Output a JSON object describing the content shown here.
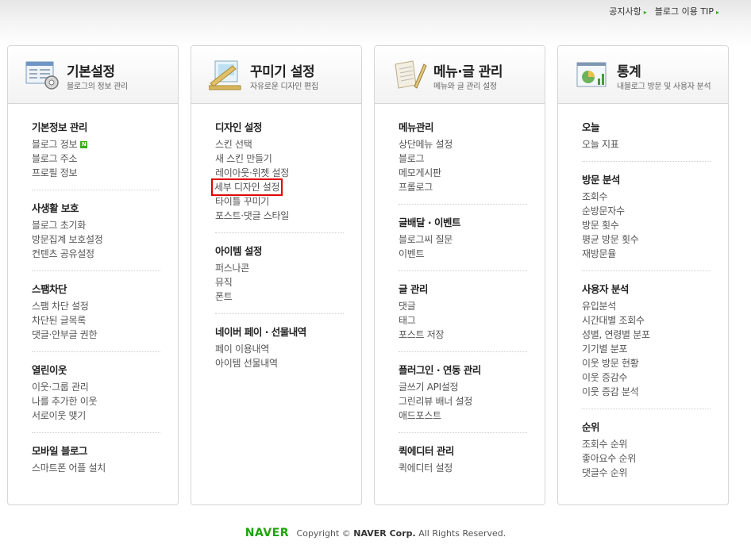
{
  "top_links": [
    {
      "label": "공지사항"
    },
    {
      "label": "블로그 이용 TIP"
    }
  ],
  "panels": [
    {
      "title": "기본설정",
      "subtitle": "블로그의 정보 관리",
      "icon": "settings-window-icon",
      "sections": [
        {
          "title": "기본정보 관리",
          "items": [
            "블로그 정보",
            "블로그 주소",
            "프로필 정보"
          ]
        },
        {
          "title": "사생활 보호",
          "items": [
            "블로그 초기화",
            "방문집계 보호설정",
            "컨텐츠 공유설정"
          ]
        },
        {
          "title": "스팸차단",
          "items": [
            "스팸 차단 설정",
            "차단된 글목록",
            "댓글·안부글 권한"
          ]
        },
        {
          "title": "열린이웃",
          "items": [
            "이웃·그룹 관리",
            "나를 추가한 이웃",
            "서로이웃 맺기"
          ]
        },
        {
          "title": "모바일 블로그",
          "items": [
            "스마트폰 어플 설치"
          ]
        }
      ],
      "new_badge": "N"
    },
    {
      "title": "꾸미기 설정",
      "subtitle": "자유로운 디자인 편집",
      "icon": "design-ruler-icon",
      "sections": [
        {
          "title": "디자인 설정",
          "items": [
            "스킨 선택",
            "새 스킨 만들기",
            "레이아웃·위젯 설정",
            "세부 디자인 설정",
            "타이틀 꾸미기",
            "포스트·댓글 스타일"
          ]
        },
        {
          "title": "아이템 설정",
          "items": [
            "퍼스나콘",
            "뮤직",
            "폰트"
          ]
        },
        {
          "title": "네이버 페이 · 선물내역",
          "items": [
            "페이 이용내역",
            "아이템 선물내역"
          ]
        }
      ]
    },
    {
      "title": "메뉴·글 관리",
      "subtitle": "메뉴와 글 관리 설정",
      "icon": "document-pen-icon",
      "sections": [
        {
          "title": "메뉴관리",
          "items": [
            "상단메뉴 설정",
            "블로그",
            "메모게시판",
            "프롤로그"
          ]
        },
        {
          "title": "글배달 · 이벤트",
          "items": [
            "블로그씨 질문",
            "이벤트"
          ]
        },
        {
          "title": "글 관리",
          "items": [
            "댓글",
            "태그",
            "포스트 저장"
          ]
        },
        {
          "title": "플러그인 · 연동 관리",
          "items": [
            "글쓰기 API설정",
            "그린리뷰 배너 설정",
            "애드포스트"
          ]
        },
        {
          "title": "퀵에디터 관리",
          "items": [
            "퀵에디터 설정"
          ]
        }
      ]
    },
    {
      "title": "통계",
      "subtitle": "내블로그 방문 및 사용자 분석",
      "icon": "statistics-chart-icon",
      "sections": [
        {
          "title": "오늘",
          "items": [
            "오늘 지표"
          ]
        },
        {
          "title": "방문 분석",
          "items": [
            "조회수",
            "순방문자수",
            "방문 횟수",
            "평균 방문 횟수",
            "재방문율"
          ]
        },
        {
          "title": "사용자 분석",
          "items": [
            "유입분석",
            "시간대별 조회수",
            "성별, 연령별 분포",
            "기기별 분포",
            "이웃 방문 현황",
            "이웃 증감수",
            "이웃 증감 분석"
          ]
        },
        {
          "title": "순위",
          "items": [
            "조회수 순위",
            "좋아요수 순위",
            "댓글수 순위"
          ]
        }
      ]
    }
  ],
  "footer": {
    "logo": "NAVER",
    "copyright": "Copyright ©",
    "corp": "NAVER Corp.",
    "rights": "All Rights Reserved."
  },
  "colors": {
    "accent_green": "#3cab1c",
    "highlight_red": "#e00000"
  }
}
